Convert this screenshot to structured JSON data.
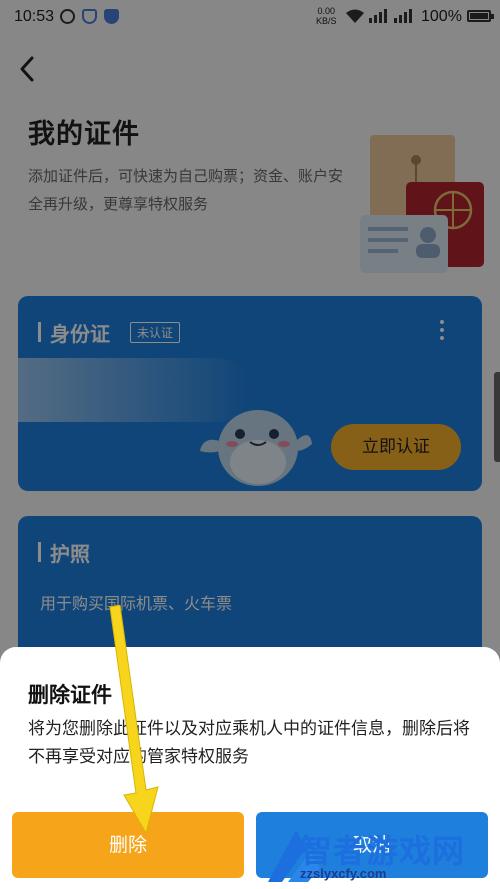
{
  "status_bar": {
    "time": "10:53",
    "net_speed_value": "0.00",
    "net_speed_unit": "KB/S",
    "battery": "100%",
    "battery_level": 1.0
  },
  "page": {
    "title": "我的证件",
    "subtitle": "添加证件后，可快速为自己购票；资金、账户安全再升级，更尊享特权服务"
  },
  "id_card": {
    "title": "身份证",
    "badge": "未认证",
    "verify_label": "立即认证"
  },
  "passport": {
    "title": "护照",
    "description": "用于购买国际机票、火车票"
  },
  "dialog": {
    "title": "删除证件",
    "body": "将为您删除此证件以及对应乘机人中的证件信息，删除后将不再享受对应的管家特权服务",
    "delete_label": "删除",
    "cancel_label": "取消"
  },
  "watermark": {
    "text": "智者游戏网",
    "url": "zzslyxcfy.com"
  },
  "colors": {
    "card_blue": "#1e7fdc",
    "accent_orange": "#f6a41a",
    "verify_yellow": "#f6b02b"
  }
}
